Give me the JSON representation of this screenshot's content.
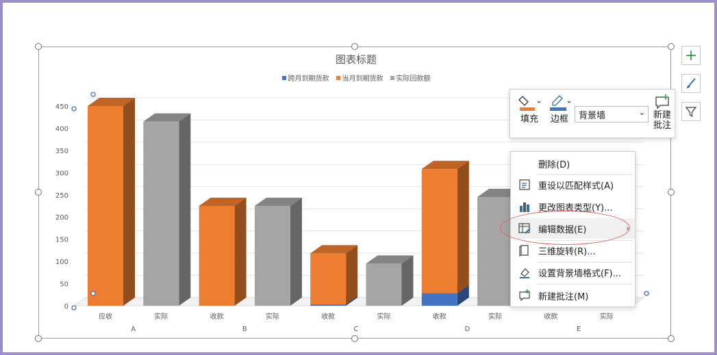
{
  "chart_data": {
    "type": "bar",
    "title": "图表标题",
    "legend": [
      "跨月到期货款",
      "当月到期货款",
      "实际回款额"
    ],
    "colors": [
      "#4472c4",
      "#ed7d31",
      "#a5a5a5"
    ],
    "groups": [
      "A",
      "B",
      "C",
      "D",
      "E"
    ],
    "categories": [
      "应收",
      "实际",
      "收款",
      "实际",
      "收款",
      "实际",
      "收款",
      "实际",
      "收款",
      "实际"
    ],
    "group_of_category": [
      0,
      0,
      1,
      1,
      2,
      2,
      3,
      3,
      4,
      4
    ],
    "series": [
      {
        "name": "跨月到期货款",
        "values": [
          0,
          0,
          0,
          0,
          3,
          0,
          28,
          0,
          null,
          null
        ]
      },
      {
        "name": "当月到期货款",
        "values": [
          450,
          0,
          225,
          0,
          115,
          0,
          280,
          0,
          null,
          null
        ]
      },
      {
        "name": "实际回款额",
        "values": [
          0,
          415,
          0,
          225,
          0,
          95,
          0,
          245,
          null,
          null
        ]
      }
    ],
    "ylim": [
      0,
      450
    ],
    "yticks": [
      "0",
      "50",
      "100",
      "150",
      "200",
      "250",
      "300",
      "350",
      "400",
      "450"
    ],
    "grid": true,
    "legend_position": "top",
    "three_d": true
  },
  "side_buttons": [
    "plus-icon",
    "brush-icon",
    "filter-icon"
  ],
  "format_toolbar": {
    "fill_label": "填充",
    "border_label": "边框",
    "element_select": "背景墙",
    "new_comment_line1": "新建",
    "new_comment_line2": "批注"
  },
  "context_menu": [
    {
      "label": "删除(D)",
      "icon": "delete-icon"
    },
    {
      "label": "重设以匹配样式(A)",
      "icon": "reset-style-icon"
    },
    {
      "label": "更改图表类型(Y)...",
      "icon": "chart-type-icon"
    },
    {
      "label": "编辑数据(E)",
      "icon": "edit-data-icon",
      "has_submenu": true
    },
    {
      "label": "三维旋转(R)...",
      "icon": "rotate-3d-icon"
    },
    {
      "label": "设置背景墙格式(F)...",
      "icon": "format-icon"
    },
    {
      "label": "新建批注(M)",
      "icon": "comment-icon"
    }
  ]
}
